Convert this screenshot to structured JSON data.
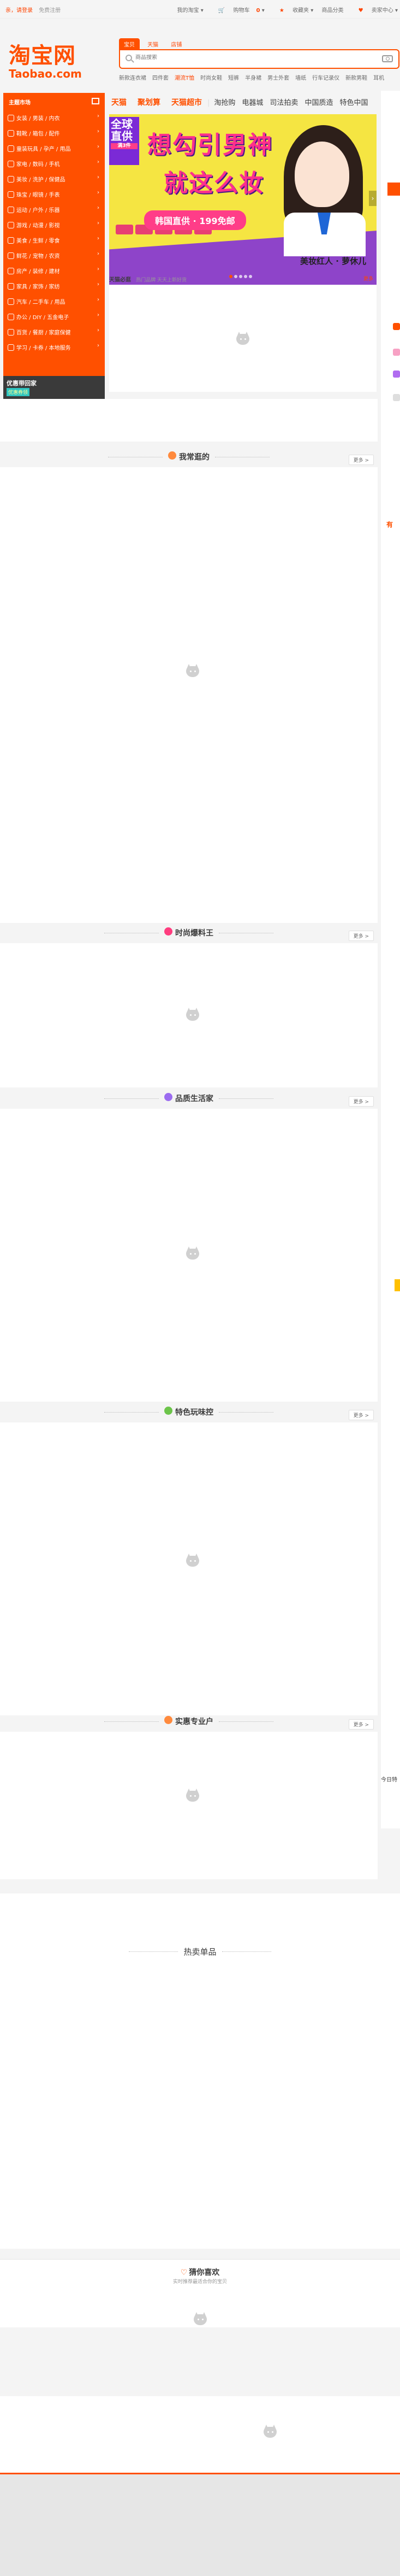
{
  "topbar": {
    "left": [
      "亲，请登录",
      "免费注册"
    ],
    "right": {
      "my_taobao": "我的淘宝",
      "cart": "购物车",
      "cart_count": "0",
      "favorites": "收藏夹",
      "seller_center": "商品分类",
      "seller": "卖家中心"
    }
  },
  "logo": {
    "cn": "淘宝网",
    "en": "Taobao.com"
  },
  "search": {
    "tabs": [
      "宝贝",
      "天猫",
      "店铺"
    ],
    "placeholder": "商品搜索"
  },
  "hot_words": [
    {
      "t": "新款连衣裙",
      "hl": false
    },
    {
      "t": "四件套",
      "hl": false
    },
    {
      "t": "潮流T恤",
      "hl": true
    },
    {
      "t": "时尚女鞋",
      "hl": false
    },
    {
      "t": "短裤",
      "hl": false
    },
    {
      "t": "半身裙",
      "hl": false
    },
    {
      "t": "男士外套",
      "hl": false
    },
    {
      "t": "墙纸",
      "hl": false
    },
    {
      "t": "行车记录仪",
      "hl": false
    },
    {
      "t": "新款男鞋",
      "hl": false
    },
    {
      "t": "耳机",
      "hl": false
    }
  ],
  "category": {
    "title": "主题市场",
    "items": [
      "女装 / 男装 / 内衣",
      "鞋靴 / 箱包 / 配件",
      "童装玩具 / 孕产 / 用品",
      "家电 / 数码 / 手机",
      "美妆 / 洗护 / 保健品",
      "珠宝 / 眼镜 / 手表",
      "运动 / 户外 / 乐器",
      "游戏 / 动漫 / 影视",
      "美食 / 生鲜 / 零食",
      "鲜花 / 宠物 / 农资",
      "房产 / 装修 / 建材",
      "家具 / 家饰 / 家纺",
      "汽车 / 二手车 / 用品",
      "办公 / DIY / 五金电子",
      "百货 / 餐厨 / 家庭保健",
      "学习 / 卡券 / 本地服务"
    ],
    "ad": {
      "t1": "优惠带回家",
      "t2": "优惠券领"
    }
  },
  "channels": {
    "big": [
      "天猫",
      "聚划算",
      "天猫超市"
    ],
    "normal": [
      "淘抢购",
      "电器城",
      "司法拍卖",
      "中国质造",
      "特色中国"
    ]
  },
  "banner": {
    "box": "全球直供",
    "box_sub": "满3件",
    "line1": "想勾引男神",
    "line2": "就这么妆",
    "pill": "韩国直供 · 199免邮",
    "caption": "美妆红人 · 萝休儿"
  },
  "must_buy": {
    "label": "天猫必逛",
    "text": "热门品牌 天天上新好货",
    "more": "更多"
  },
  "right_col": {
    "mint": "有",
    "today": "今日特"
  },
  "sections": [
    {
      "title": "我常逛的",
      "more": "更多 >",
      "color": "#ff8a3d"
    },
    {
      "title": "时尚爆料王",
      "more": "更多 >",
      "color": "#ff3d7f"
    },
    {
      "title": "品质生活家",
      "more": "更多 >",
      "color": "#9b6cf0"
    },
    {
      "title": "特色玩味控",
      "more": "更多 >",
      "color": "#6cc44a"
    },
    {
      "title": "实惠专业户",
      "more": "更多 >",
      "color": "#ff8a3d"
    }
  ],
  "hot": {
    "title": "热卖单品"
  },
  "guess": {
    "title": "猜你喜欢",
    "sub": "实时推荐最适合你的宝贝"
  },
  "colors": {
    "brand": "#ff5000"
  }
}
